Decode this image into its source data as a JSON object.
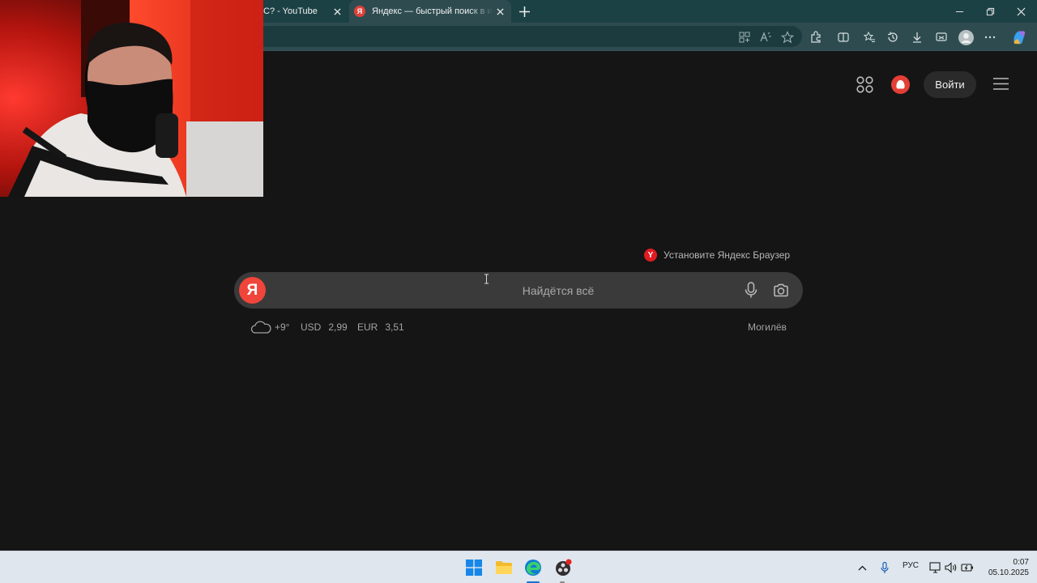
{
  "browser": {
    "tabs": [
      {
        "title": "C? - YouTube"
      },
      {
        "title": "Яндекс — быстрый поиск в инте",
        "favicon": "Я"
      }
    ]
  },
  "page": {
    "login_label": "Войти",
    "install_banner": "Установите Яндекс Браузер",
    "install_badge": "Y",
    "logo_letter": "Я",
    "search_placeholder": "Найдётся всё",
    "weather": "+9°",
    "currencies": [
      {
        "code": "USD",
        "value": "2,99"
      },
      {
        "code": "EUR",
        "value": "3,51"
      }
    ],
    "city": "Могилёв"
  },
  "taskbar": {
    "language": "РУС",
    "time": "0:07",
    "date": "05.10.2025"
  },
  "colors": {
    "yandex_red": "#f0453b",
    "tab_bar": "#1c4145",
    "page_bg": "#151515"
  }
}
